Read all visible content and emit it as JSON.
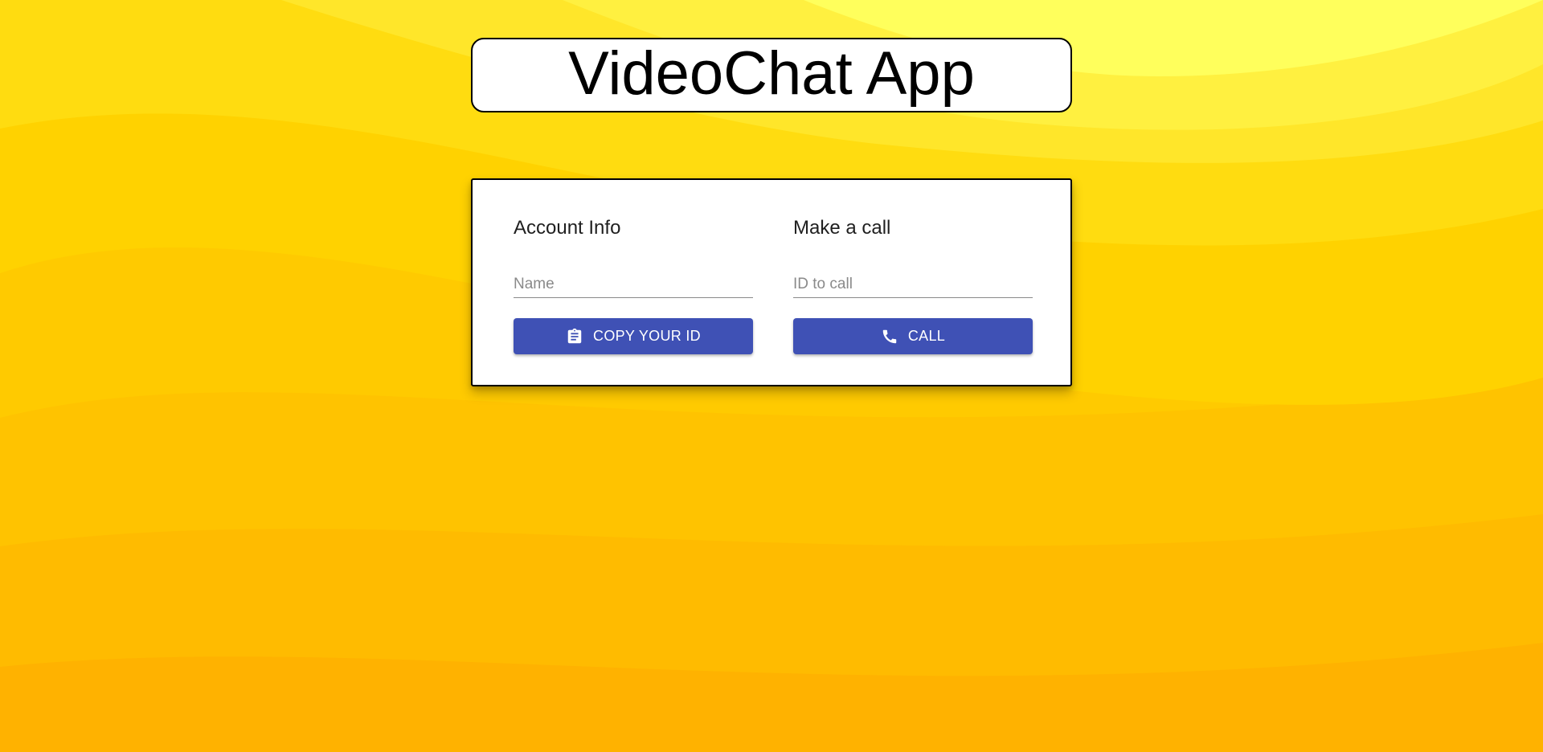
{
  "app": {
    "title": "VideoChat App"
  },
  "account": {
    "heading": "Account Info",
    "name_placeholder": "Name",
    "name_value": "",
    "copy_button_label": "COPY YOUR ID",
    "copy_button_icon": "clipboard-icon"
  },
  "call": {
    "heading": "Make a call",
    "id_placeholder": "ID to call",
    "id_value": "",
    "call_button_label": "CALL",
    "call_button_icon": "phone-icon"
  },
  "colors": {
    "background_light": "#ffff66",
    "background_dark": "#ffb300",
    "button": "#3f51b5",
    "card": "#ffffff",
    "border": "#000000"
  }
}
